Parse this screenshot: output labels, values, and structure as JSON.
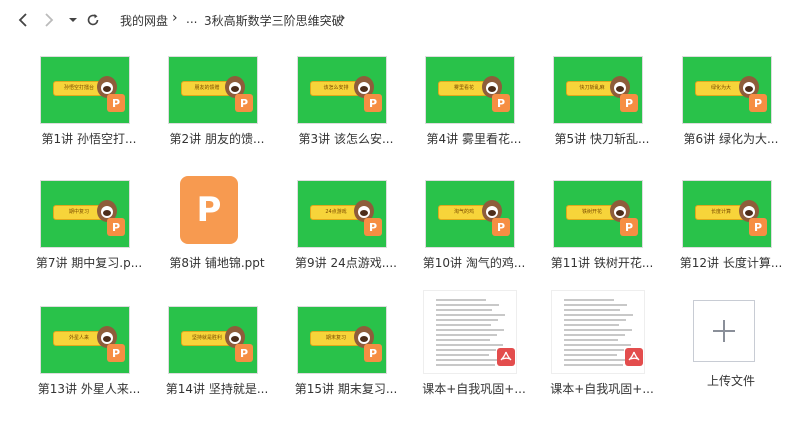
{
  "toolbar": {
    "back_icon": "back-arrow-icon",
    "forward_icon": "forward-arrow-icon",
    "history_icon": "dropdown-caret-icon",
    "refresh_icon": "refresh-icon",
    "breadcrumb": [
      "我的网盘",
      "...",
      "3秋高斯数学三阶思维突破"
    ]
  },
  "files": [
    {
      "label": "第1讲 孙悟空打...",
      "banner": "孙悟空打擂台",
      "type": "ppt"
    },
    {
      "label": "第2讲 朋友的馈...",
      "banner": "朋友的馈赠",
      "type": "ppt"
    },
    {
      "label": "第3讲 该怎么安...",
      "banner": "该怎么安排",
      "type": "ppt"
    },
    {
      "label": "第4讲 雾里看花...",
      "banner": "雾里看花",
      "type": "ppt"
    },
    {
      "label": "第5讲 快刀斩乱...",
      "banner": "快刀斩乱麻",
      "type": "ppt"
    },
    {
      "label": "第6讲 绿化为大...",
      "banner": "绿化为大",
      "type": "ppt"
    },
    {
      "label": "第7讲 期中复习.p...",
      "banner": "期中复习",
      "type": "ppt"
    },
    {
      "label": "第8讲 铺地锦.ppt",
      "banner": "",
      "type": "ppt-big"
    },
    {
      "label": "第9讲 24点游戏....",
      "banner": "24点游戏",
      "type": "ppt"
    },
    {
      "label": "第10讲 淘气的鸡...",
      "banner": "淘气的鸡",
      "type": "ppt"
    },
    {
      "label": "第11讲 铁树开花...",
      "banner": "铁树开花",
      "type": "ppt"
    },
    {
      "label": "第12讲 长度计算...",
      "banner": "长度计算",
      "type": "ppt"
    },
    {
      "label": "第13讲 外星人来...",
      "banner": "外星人来",
      "type": "ppt"
    },
    {
      "label": "第14讲 坚持就是...",
      "banner": "坚持就是胜利",
      "type": "ppt"
    },
    {
      "label": "第15讲 期末复习...",
      "banner": "期末复习",
      "type": "ppt"
    },
    {
      "label": "课本+自我巩固+...",
      "banner": "",
      "type": "pdf"
    },
    {
      "label": "课本+自我巩固+...",
      "banner": "",
      "type": "pdf"
    },
    {
      "label": "上传文件",
      "banner": "",
      "type": "upload"
    }
  ],
  "badges": {
    "ppt_letter": "P",
    "pdf_letter": "⅄"
  },
  "colors": {
    "green": "#29c24a",
    "ppt_orange": "#f68e43",
    "pdf_red": "#e34d4d"
  }
}
